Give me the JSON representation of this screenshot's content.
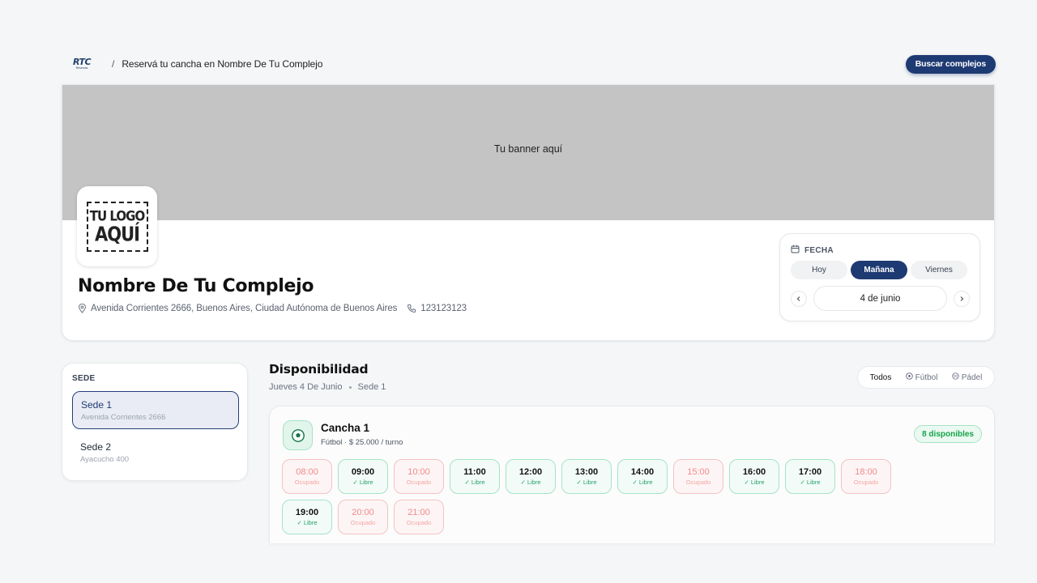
{
  "header": {
    "brand_letters": "RTC",
    "brand_sub": "Reservas",
    "separator": "/",
    "title": "Reservá tu cancha en Nombre De Tu Complejo",
    "search_button": "Buscar complejos"
  },
  "hero": {
    "banner_text": "Tu banner aquí",
    "logo_line1": "TU LOGO",
    "logo_line2": "AQUÍ",
    "name": "Nombre De Tu Complejo",
    "address": "Avenida Corrientes 2666, Buenos Aires, Ciudad Autónoma de Buenos Aires",
    "phone": "123123123"
  },
  "date_picker": {
    "label": "FECHA",
    "options": [
      "Hoy",
      "Mañana",
      "Viernes"
    ],
    "selected": "Mañana",
    "current_date": "4 de junio"
  },
  "sede": {
    "title": "SEDE",
    "items": [
      {
        "name": "Sede 1",
        "address": "Avenida Corrientes 2666"
      },
      {
        "name": "Sede 2",
        "address": "Ayacucho 400"
      }
    ]
  },
  "availability": {
    "title": "Disponibilidad",
    "date": "Jueves 4 De Junio",
    "sede": "Sede 1",
    "filters": [
      "Todos",
      "Fútbol",
      "Pádel"
    ]
  },
  "court": {
    "name": "Cancha 1",
    "info": "Fútbol · $ 25.000 / turno",
    "badge": "8 disponibles",
    "slots": [
      {
        "time": "08:00",
        "status": "Ocupado",
        "free": false
      },
      {
        "time": "09:00",
        "status": "✓ Libre",
        "free": true
      },
      {
        "time": "10:00",
        "status": "Ocupado",
        "free": false
      },
      {
        "time": "11:00",
        "status": "✓ Libre",
        "free": true
      },
      {
        "time": "12:00",
        "status": "✓ Libre",
        "free": true
      },
      {
        "time": "13:00",
        "status": "✓ Libre",
        "free": true
      },
      {
        "time": "14:00",
        "status": "✓ Libre",
        "free": true
      },
      {
        "time": "15:00",
        "status": "Ocupado",
        "free": false
      },
      {
        "time": "16:00",
        "status": "✓ Libre",
        "free": true
      },
      {
        "time": "17:00",
        "status": "✓ Libre",
        "free": true
      },
      {
        "time": "18:00",
        "status": "Ocupado",
        "free": false
      },
      {
        "time": "19:00",
        "status": "✓ Libre",
        "free": true
      },
      {
        "time": "20:00",
        "status": "Ocupado",
        "free": false
      },
      {
        "time": "21:00",
        "status": "Ocupado",
        "free": false
      }
    ]
  },
  "colors": {
    "brand": "#1e3a73",
    "free": "#22a06b",
    "busy": "#f08a8a",
    "banner": "#c4c4c4"
  }
}
